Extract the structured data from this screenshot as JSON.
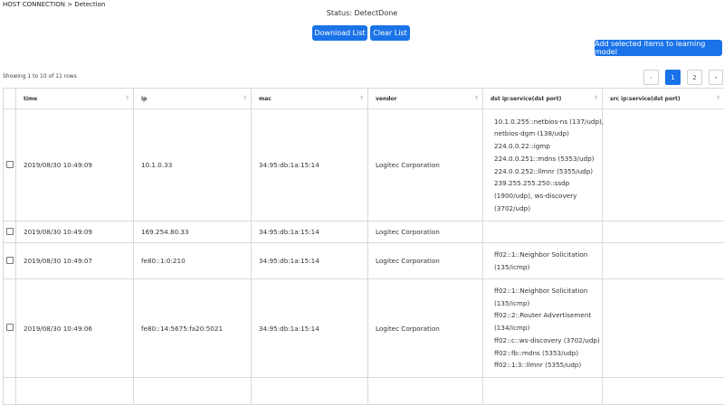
{
  "breadcrumb": "HOST CONNECTION > Detection",
  "status": "Status: DetectDone",
  "buttons": {
    "download": "Download List",
    "clear": "Clear List",
    "add": "Add selected items to learning model"
  },
  "showing": "Showing 1 to 10 of 11 rows",
  "pagination": {
    "prev": "‹",
    "pages": [
      "1",
      "2"
    ],
    "next": "›",
    "current": "1"
  },
  "table": {
    "headers": [
      "time",
      "ip",
      "mac",
      "vendor",
      "dst ip:service(dst port)",
      "src ip:service(dst port)"
    ],
    "rows": [
      {
        "time": "2019/08/30 10:49:09",
        "ip": "10.1.0.33",
        "mac": "34:95:db:1a:15:14",
        "vendor": "Logitec Corporation",
        "dst": [
          "10.1.0.255::netbios-ns (137/udp),",
          "netbios-dgm (138/udp)",
          "224.0.0.22::igmp",
          "224.0.0.251::mdns (5353/udp)",
          "224.0.0.252::llmnr (5355/udp)",
          "239.255.255.250::ssdp",
          "(1900/udp), ws-discovery",
          "(3702/udp)"
        ],
        "src": []
      },
      {
        "time": "2019/08/30 10:49:09",
        "ip": "169.254.80.33",
        "mac": "34:95:db:1a:15:14",
        "vendor": "Logitec Corporation",
        "dst": [],
        "src": []
      },
      {
        "time": "2019/08/30 10:49:07",
        "ip": "fe80::1:0:210",
        "mac": "34:95:db:1a:15:14",
        "vendor": "Logitec Corporation",
        "dst": [
          "ff02::1::Neighbor Solicitation",
          "(135/icmp)"
        ],
        "src": []
      },
      {
        "time": "2019/08/30 10:49:06",
        "ip": "fe80::14:5675:fa20:5021",
        "mac": "34:95:db:1a:15:14",
        "vendor": "Logitec Corporation",
        "dst": [
          "ff02::1::Neighbor Solicitation",
          "(135/icmp)",
          "ff02::2::Router Advertisement",
          "(134/icmp)",
          "ff02::c::ws-discovery (3702/udp)",
          "ff02::fb::mdns (5353/udp)",
          "ff02::1:3::llmnr (5355/udp)"
        ],
        "src": []
      },
      {
        "time": "",
        "ip": "",
        "mac": "",
        "vendor": "",
        "dst": [],
        "src": []
      }
    ]
  },
  "colors": {
    "primary": "#1a73e8"
  },
  "icons": {
    "sort": "sort-icon",
    "checkbox": "checkbox-icon"
  }
}
